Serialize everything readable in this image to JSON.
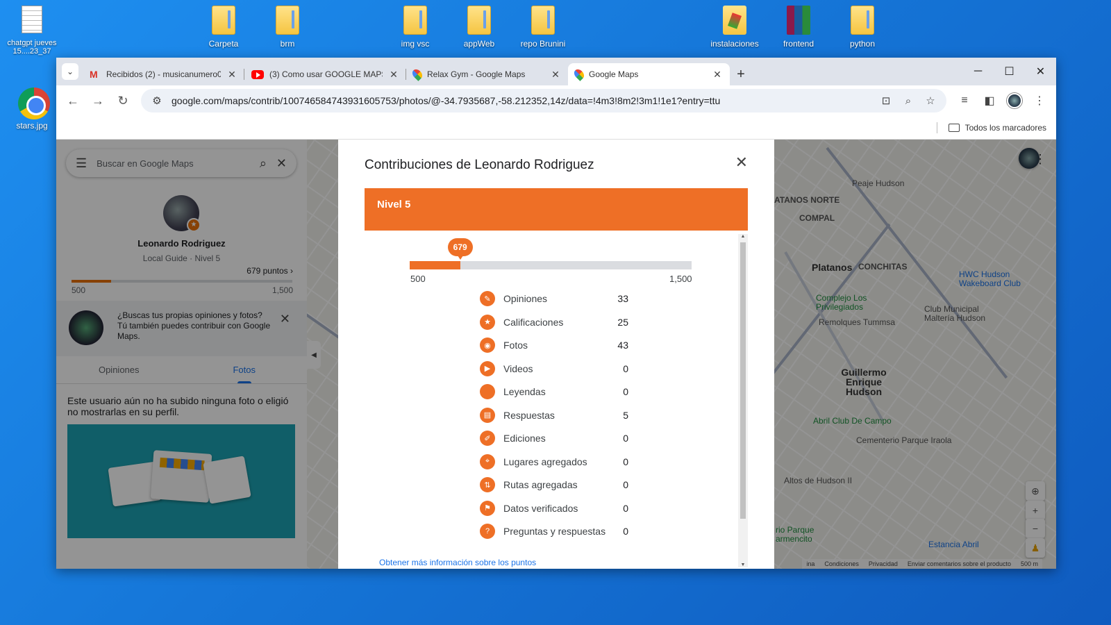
{
  "desktop": {
    "icons": [
      {
        "label": "chatgpt jueves 15....23_37",
        "icon": "text-file-icon"
      },
      {
        "label": "stars.jpg",
        "icon": "chrome-icon"
      },
      {
        "label": "Carpeta",
        "icon": "folder-icon"
      },
      {
        "label": "brm",
        "icon": "folder-icon"
      },
      {
        "label": "img vsc",
        "icon": "folder-icon"
      },
      {
        "label": "appWeb",
        "icon": "folder-icon"
      },
      {
        "label": "repo Brunini",
        "icon": "folder-icon"
      },
      {
        "label": "instalaciones",
        "icon": "folder-gimp-icon"
      },
      {
        "label": "frontend",
        "icon": "winrar-icon"
      },
      {
        "label": "python",
        "icon": "folder-icon"
      }
    ]
  },
  "browser": {
    "tabs": [
      {
        "title": "Recibidos (2) - musicanumero0",
        "favicon": "gmail-icon"
      },
      {
        "title": "(3) Como usar GOOGLE MAPS (",
        "favicon": "youtube-icon"
      },
      {
        "title": "Relax Gym - Google Maps",
        "favicon": "maps-icon"
      },
      {
        "title": "Google Maps",
        "favicon": "maps-icon"
      }
    ],
    "url": "google.com/maps/contrib/100746584743931605753/photos/@-34.7935687,-58.212352,14z/data=!4m3!8m2!3m1!1e1?entry=ttu",
    "bookmarks_label": "Todos los marcadores"
  },
  "left_panel": {
    "search_placeholder": "Buscar en Google Maps",
    "name": "Leonardo Rodriguez",
    "level": "Local Guide · Nivel 5",
    "points": "679 puntos",
    "progress_fraction": 0.179,
    "range_min": "500",
    "range_max": "1,500",
    "promo_text": "¿Buscas tus propias opiniones y fotos? Tú también puedes contribuir con Google Maps.",
    "tabs": [
      "Opiniones",
      "Fotos"
    ],
    "no_photos_text": "Este usuario aún no ha subido ninguna foto o eligió no mostrarlas en su perfil."
  },
  "map": {
    "labels": [
      "Peaje Hudson",
      "ATANOS NORTE",
      "COMPAL",
      "Platanos",
      "CONCHITAS",
      "HWC Hudson Wakeboard Club",
      "Complejo Los Privilegiados",
      "Club Municipal Maltería Hudson",
      "Remolques Tummsa",
      "Guillermo Enrique Hudson",
      "Abril Club De Campo",
      "Cementerio Parque Iraola",
      "Altos de Hudson II",
      "rio Parque armencito",
      "Estancia Abril"
    ],
    "footer": [
      "ina",
      "Condiciones",
      "Privacidad",
      "Enviar comentarios sobre el producto",
      "500 m"
    ]
  },
  "dialog": {
    "title": "Contribuciones de Leonardo Rodriguez",
    "level": "Nivel 5",
    "points": "679",
    "progress_fraction": 0.179,
    "range_min": "500",
    "range_max": "1,500",
    "stats": [
      {
        "label": "Opiniones",
        "value": "33",
        "icon": "review-icon"
      },
      {
        "label": "Calificaciones",
        "value": "25",
        "icon": "star-icon"
      },
      {
        "label": "Fotos",
        "value": "43",
        "icon": "camera-icon"
      },
      {
        "label": "Videos",
        "value": "0",
        "icon": "video-icon"
      },
      {
        "label": "Leyendas",
        "value": "0",
        "icon": "caption-icon"
      },
      {
        "label": "Respuestas",
        "value": "5",
        "icon": "answer-icon"
      },
      {
        "label": "Ediciones",
        "value": "0",
        "icon": "edit-icon"
      },
      {
        "label": "Lugares agregados",
        "value": "0",
        "icon": "place-icon"
      },
      {
        "label": "Rutas agregadas",
        "value": "0",
        "icon": "road-icon"
      },
      {
        "label": "Datos verificados",
        "value": "0",
        "icon": "flag-icon"
      },
      {
        "label": "Preguntas y respuestas",
        "value": "0",
        "icon": "qa-icon"
      }
    ],
    "more_link": "Obtener más información sobre los puntos"
  }
}
